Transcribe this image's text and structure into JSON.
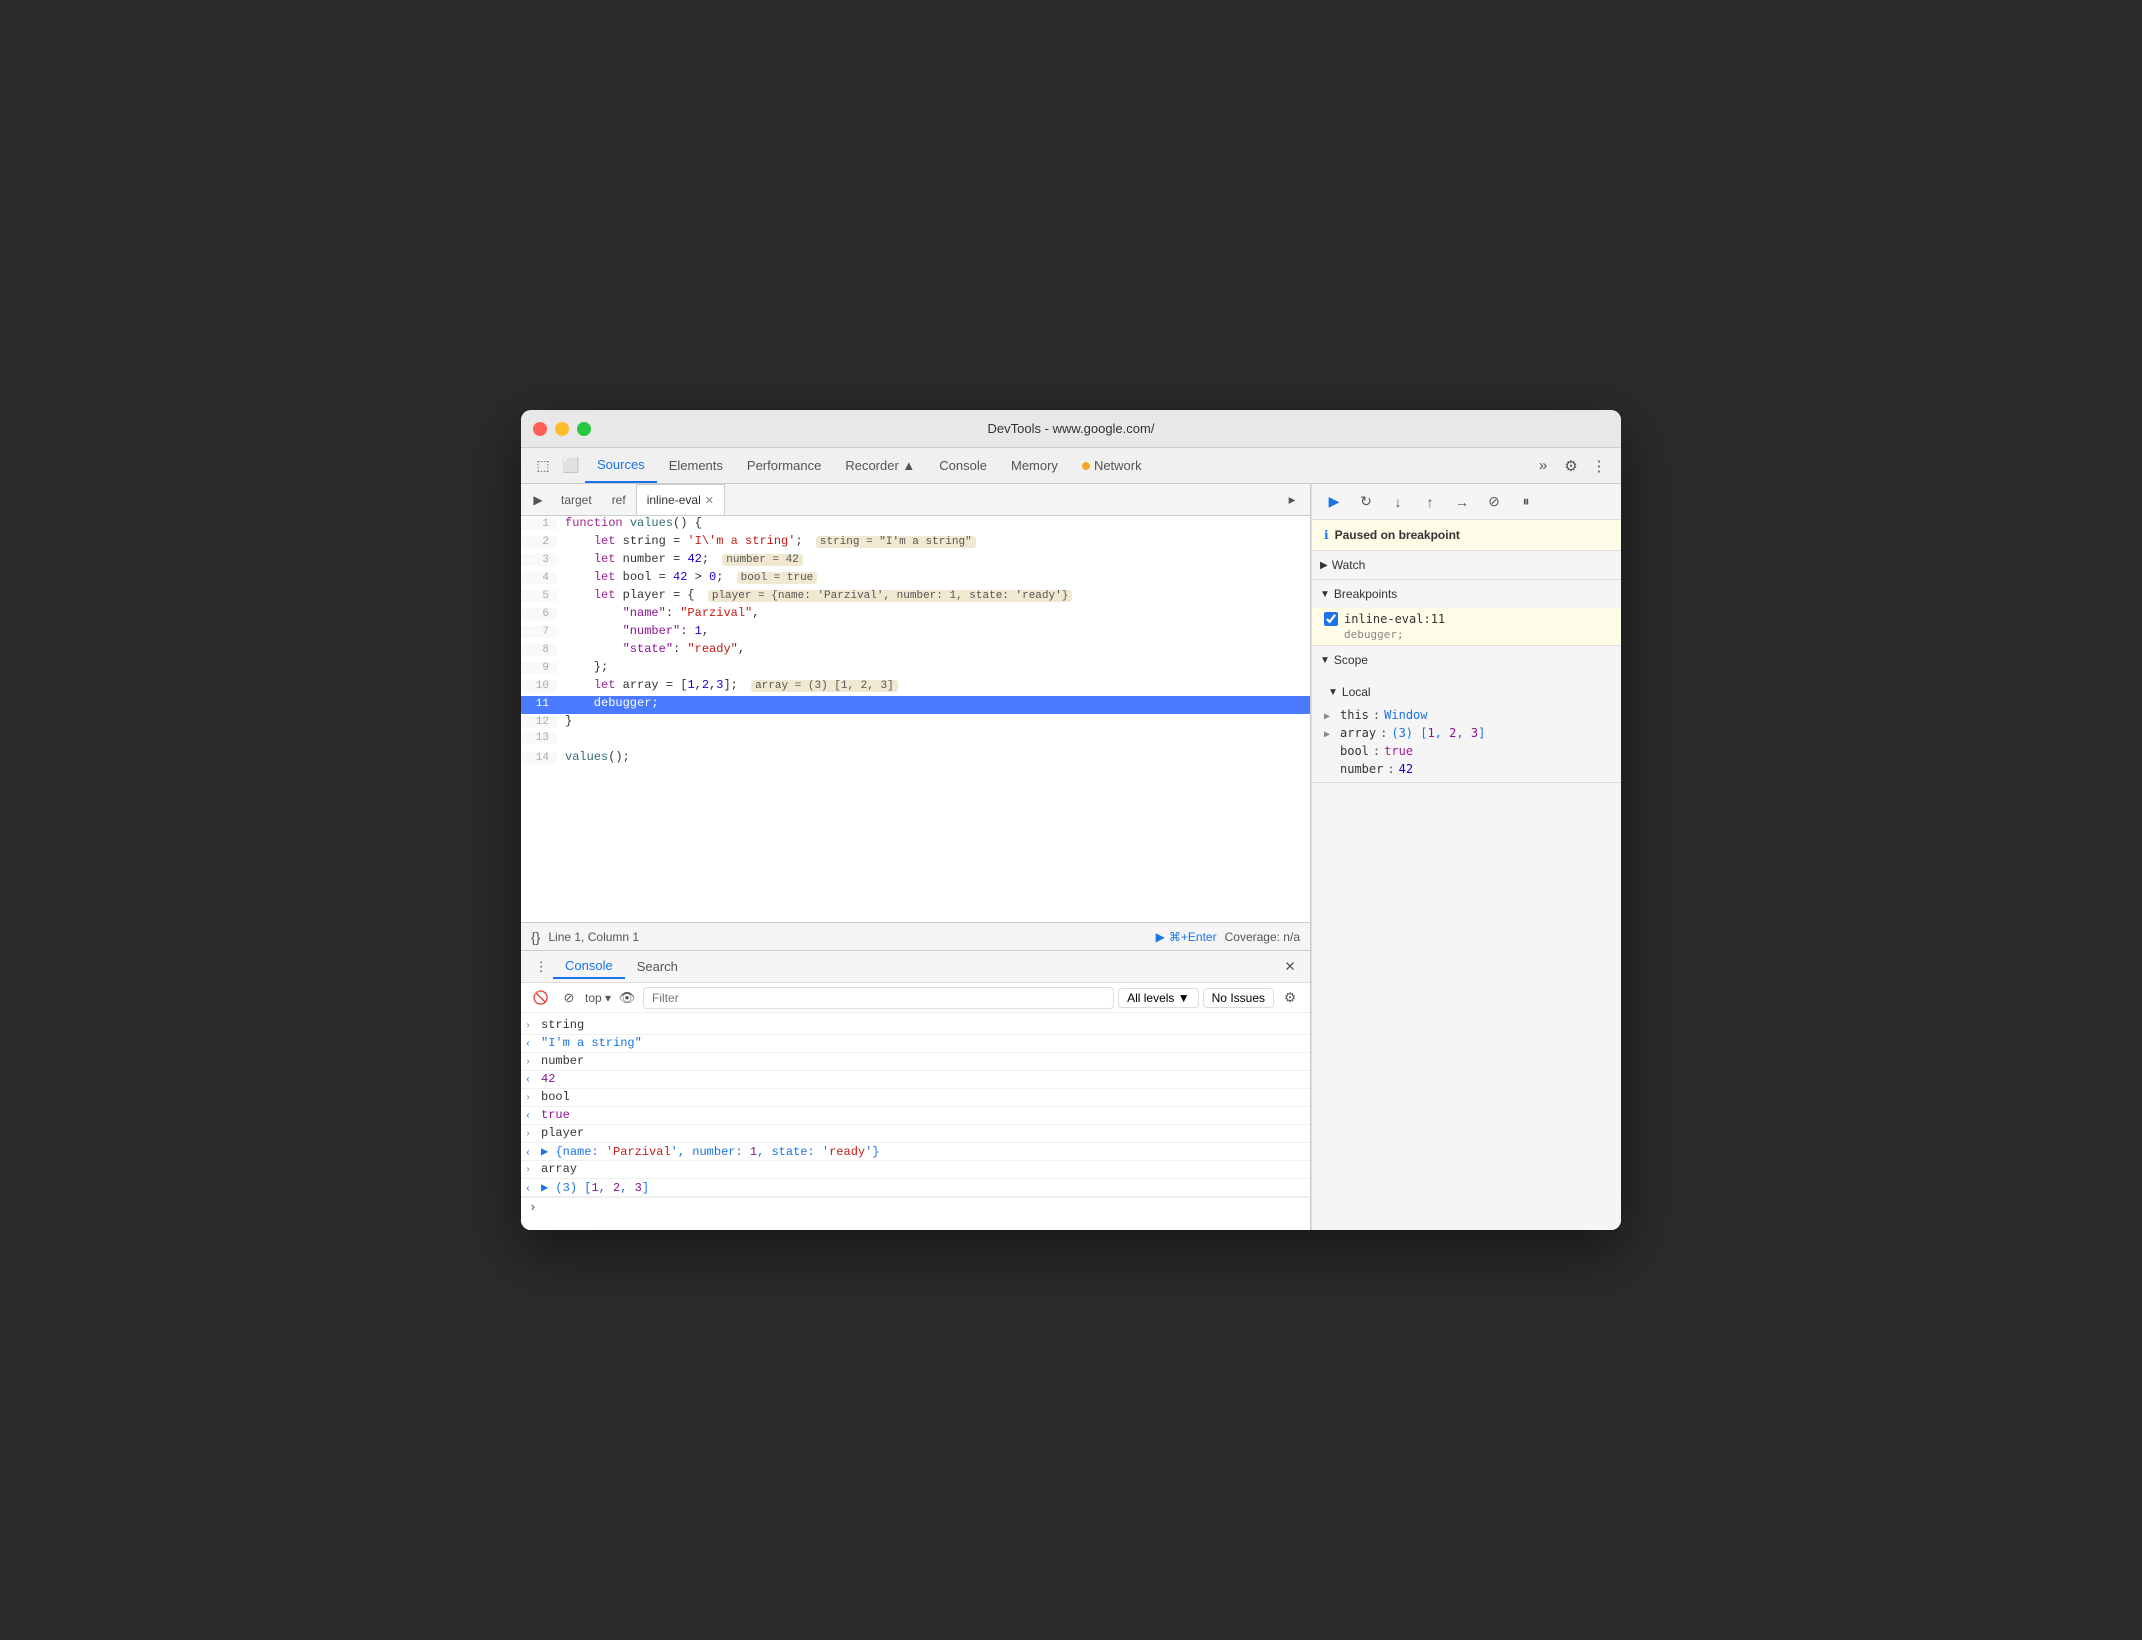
{
  "window": {
    "title": "DevTools - www.google.com/"
  },
  "tabs": {
    "items": [
      {
        "label": "Sources",
        "active": true
      },
      {
        "label": "Elements",
        "active": false
      },
      {
        "label": "Performance",
        "active": false
      },
      {
        "label": "Recorder ▲",
        "active": false
      },
      {
        "label": "Console",
        "active": false
      },
      {
        "label": "Memory",
        "active": false
      },
      {
        "label": "Network",
        "active": false
      }
    ],
    "more_label": "»",
    "settings_label": "⚙",
    "more_options_label": "⋮"
  },
  "file_tabs": {
    "items": [
      {
        "label": "target",
        "active": false,
        "closeable": false
      },
      {
        "label": "ref",
        "active": false,
        "closeable": false
      },
      {
        "label": "inline-eval",
        "active": true,
        "closeable": true
      }
    ]
  },
  "code": {
    "lines": [
      {
        "num": "1",
        "text": "function values() {",
        "highlighted": false
      },
      {
        "num": "2",
        "text": "    let string = 'I\\'m a string';",
        "highlighted": false,
        "eval": "string = \"I'm a string\""
      },
      {
        "num": "3",
        "text": "    let number = 42;",
        "highlighted": false,
        "eval": "number = 42"
      },
      {
        "num": "4",
        "text": "    let bool = 42 > 0;",
        "highlighted": false,
        "eval": "bool = true"
      },
      {
        "num": "5",
        "text": "    let player = {  player = {name: 'Parzival', number: 1, state: 'ready'}",
        "highlighted": false
      },
      {
        "num": "6",
        "text": "        \"name\": \"Parzival\",",
        "highlighted": false
      },
      {
        "num": "7",
        "text": "        \"number\": 1,",
        "highlighted": false
      },
      {
        "num": "8",
        "text": "        \"state\": \"ready\",",
        "highlighted": false
      },
      {
        "num": "9",
        "text": "    };",
        "highlighted": false
      },
      {
        "num": "10",
        "text": "    let array = [1,2,3];",
        "highlighted": false,
        "eval": "array = (3) [1, 2, 3]"
      },
      {
        "num": "11",
        "text": "    debugger;",
        "highlighted": true
      },
      {
        "num": "12",
        "text": "}",
        "highlighted": false
      },
      {
        "num": "13",
        "text": "",
        "highlighted": false
      },
      {
        "num": "14",
        "text": "values();",
        "highlighted": false
      }
    ]
  },
  "status_bar": {
    "position": "Line 1, Column 1",
    "run_label": "⌘+Enter",
    "coverage": "Coverage: n/a"
  },
  "console": {
    "tabs": [
      {
        "label": "Console",
        "active": true
      },
      {
        "label": "Search",
        "active": false
      }
    ],
    "filter_placeholder": "Filter",
    "levels_label": "All levels ▼",
    "issues_label": "No Issues",
    "output": [
      {
        "arrow": "›",
        "arrow_class": "",
        "text": "string",
        "type": "normal"
      },
      {
        "arrow": "‹",
        "arrow_class": "blue",
        "text": "\"I'm a string\"",
        "type": "blue-str"
      },
      {
        "arrow": "›",
        "arrow_class": "",
        "text": "number",
        "type": "normal"
      },
      {
        "arrow": "‹",
        "arrow_class": "blue",
        "text": "42",
        "type": "purple"
      },
      {
        "arrow": "›",
        "arrow_class": "",
        "text": "bool",
        "type": "normal"
      },
      {
        "arrow": "‹",
        "arrow_class": "blue",
        "text": "true",
        "type": "purple"
      },
      {
        "arrow": "›",
        "arrow_class": "",
        "text": "player",
        "type": "normal"
      },
      {
        "arrow": "‹",
        "arrow_class": "blue",
        "text": "▶ {name: 'Parzival', number: 1, state: 'ready'}",
        "type": "blue-str"
      },
      {
        "arrow": "›",
        "arrow_class": "",
        "text": "array",
        "type": "normal"
      },
      {
        "arrow": "‹",
        "arrow_class": "blue",
        "text": "▶ (3) [1, 2, 3]",
        "type": "blue-str"
      }
    ]
  },
  "debugger": {
    "breakpoint_msg": "Paused on breakpoint",
    "buttons": [
      {
        "icon": "▶",
        "label": "resume",
        "active": true
      },
      {
        "icon": "↻",
        "label": "step-over"
      },
      {
        "icon": "↓",
        "label": "step-into"
      },
      {
        "icon": "↑",
        "label": "step-out"
      },
      {
        "icon": "→→",
        "label": "step"
      },
      {
        "icon": "⊘",
        "label": "deactivate-breakpoints"
      },
      {
        "icon": "⏸",
        "label": "pause-on-exceptions"
      }
    ],
    "watch_label": "Watch",
    "breakpoints_label": "Breakpoints",
    "breakpoint_file": "inline-eval:11",
    "breakpoint_code": "debugger;",
    "scope_label": "Scope",
    "local_label": "Local",
    "scope_items": [
      {
        "expandable": true,
        "key": "this",
        "colon": ":",
        "val": "Window",
        "val_class": ""
      },
      {
        "expandable": true,
        "key": "array",
        "colon": ":",
        "val": "(3) [1, 2, 3]",
        "val_class": ""
      },
      {
        "expandable": false,
        "key": "bool",
        "colon": ":",
        "val": "true",
        "val_class": "bool-val"
      },
      {
        "expandable": false,
        "key": "number",
        "colon": ":",
        "val": "42",
        "val_class": "num-val"
      }
    ]
  }
}
